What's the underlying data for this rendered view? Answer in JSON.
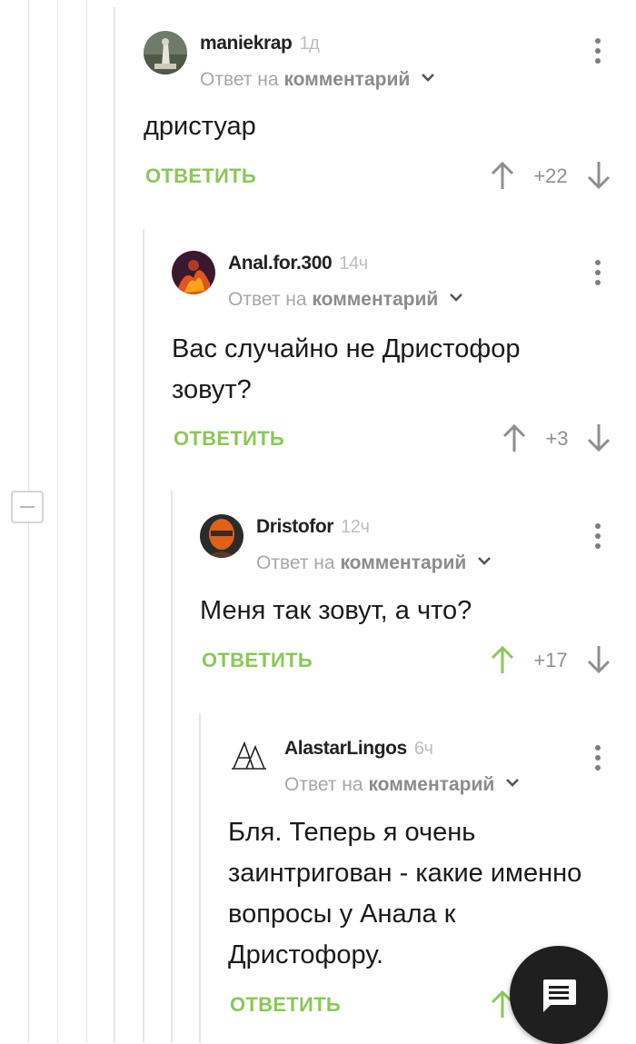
{
  "comments": [
    {
      "author": "maniekrap",
      "time": "1д",
      "reply_prefix": "Ответ на",
      "reply_link": "комментарий",
      "text": "дристуар",
      "reply_label": "ОТВЕТИТЬ",
      "rating": "+22"
    },
    {
      "author": "Anal.for.300",
      "time": "14ч",
      "reply_prefix": "Ответ на",
      "reply_link": "комментарий",
      "text": "Вас случайно не Дристофор зовут?",
      "reply_label": "ОТВЕТИТЬ",
      "rating": "+3"
    },
    {
      "author": "Dristofor",
      "time": "12ч",
      "reply_prefix": "Ответ на",
      "reply_link": "комментарий",
      "text": "Меня так зовут, а что?",
      "reply_label": "ОТВЕТИТЬ",
      "rating": "+17"
    },
    {
      "author": "AlastarLingos",
      "time": "6ч",
      "reply_prefix": "Ответ на",
      "reply_link": "комментарий",
      "text": "Бля. Теперь я очень заинтригован - какие именно вопросы у Анала к Дристофору.",
      "reply_label": "ОТВЕТИТЬ",
      "rating": ""
    }
  ],
  "colors": {
    "accent_green": "#8ac858",
    "upvoted_green": "#8ac858",
    "vote_grey": "#8f8f8f",
    "fab_bg": "#1f1f1f"
  },
  "icons": {
    "upvote": "arrow-up-icon",
    "downvote": "arrow-down-icon",
    "more": "more-vertical-icon",
    "chevron": "chevron-down-icon",
    "collapse": "collapse-minus-icon",
    "fab": "comment-bubble-icon"
  }
}
